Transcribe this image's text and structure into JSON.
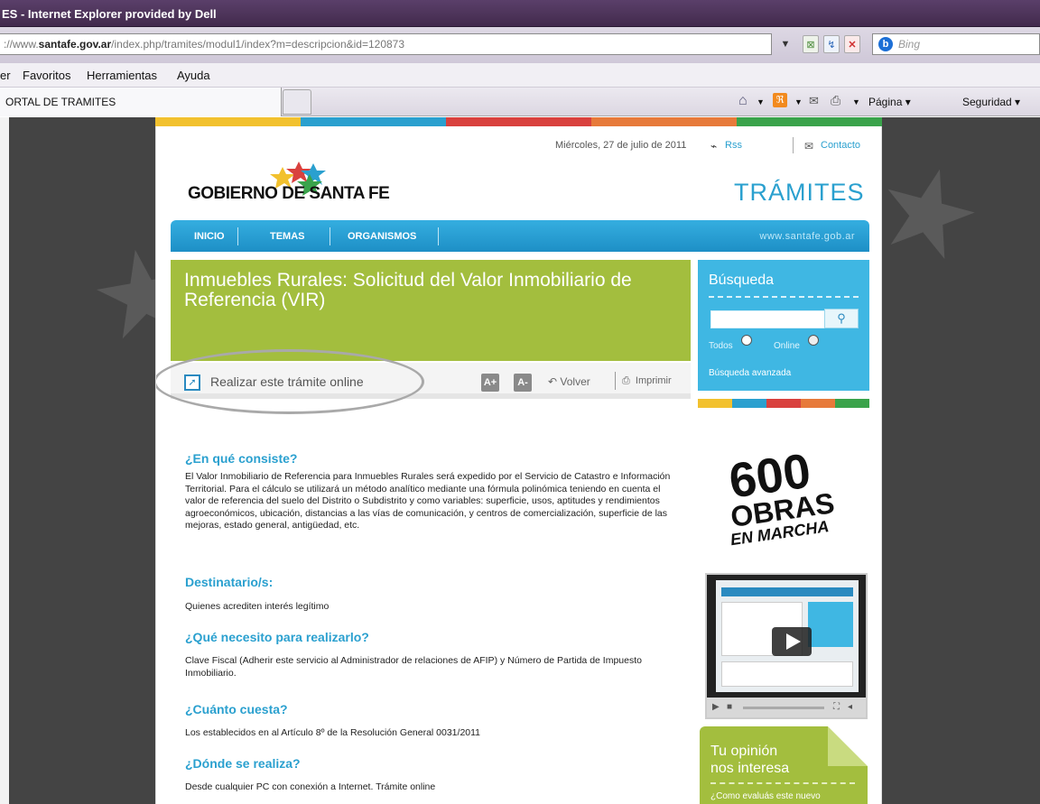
{
  "browser": {
    "title": "ES - Internet Explorer provided by Dell",
    "address_prefix": "://www.",
    "address_domain": "santafe.gov.ar",
    "address_path": "/index.php/tramites/modul1/index?m=descripcion&id=120873",
    "search_placeholder": "Bing",
    "menu": [
      "er",
      "Favoritos",
      "Herramientas",
      "Ayuda"
    ],
    "tab_title": "ORTAL DE TRAMITES",
    "commands": {
      "page": "Página ▾",
      "security": "Seguridad ▾"
    }
  },
  "site": {
    "date": "Miércoles, 27 de julio de 2011",
    "rss": "Rss",
    "contact": "Contacto",
    "logo": "GOBIERNO DE SANTA FE",
    "section": "TRÁMITES",
    "nav": [
      "INICIO",
      "TEMAS",
      "ORGANISMOS"
    ],
    "nav_url": "www.santafe.gob.ar",
    "page_title": "Inmuebles Rurales: Solicitud del Valor Inmobiliario de Referencia (VIR)",
    "actions": {
      "online": "Realizar este trámite online",
      "font_up": "A+",
      "font_down": "A-",
      "back": "Volver",
      "print": "Imprimir"
    },
    "search": {
      "title": "Búsqueda",
      "opt_all": "Todos",
      "opt_online": "Online",
      "advanced": "Búsqueda avanzada"
    },
    "sections": [
      {
        "heading": "¿En qué consiste?",
        "body": "El Valor Inmobiliario de Referencia para Inmuebles Rurales será expedido por el Servicio de Catastro e Información Territorial. Para el cálculo se utilizará un método analítico mediante una fórmula polinómica teniendo en cuenta el valor de referencia del suelo del Distrito o Subdistrito y como variables: superficie, usos, aptitudes y rendimientos agroeconómicos, ubicación, distancias a las vías de comunicación, y centros de comercialización, superficie de las mejoras, estado general, antigüedad, etc."
      },
      {
        "heading": "Destinatario/s:",
        "body": "Quienes acrediten interés legítimo"
      },
      {
        "heading": "¿Qué necesito para realizarlo?",
        "body": "Clave Fiscal (Adherir este servicio al Administrador de relaciones de AFIP) y Número de Partida de Impuesto Inmobiliario."
      },
      {
        "heading": "¿Cuánto cuesta?",
        "body": "Los establecidos en al Artículo 8º de la Resolución General 0031/2011"
      },
      {
        "heading": "¿Dónde se realiza?",
        "body": "Desde cualquier PC con conexión a Internet. Trámite online"
      }
    ],
    "banner": {
      "line1": "600",
      "line2": "OBRAS",
      "line3": "EN MARCHA"
    },
    "opinion": {
      "title1": "Tu opinión",
      "title2": "nos interesa",
      "sub": "¿Como evaluás este nuevo"
    },
    "colors": {
      "blue": "#2aa0cf",
      "green": "#a3be3e",
      "yellow": "#f2c12e",
      "red": "#d9413e",
      "orange": "#e77a3a",
      "dkgreen": "#3aa34b"
    }
  }
}
